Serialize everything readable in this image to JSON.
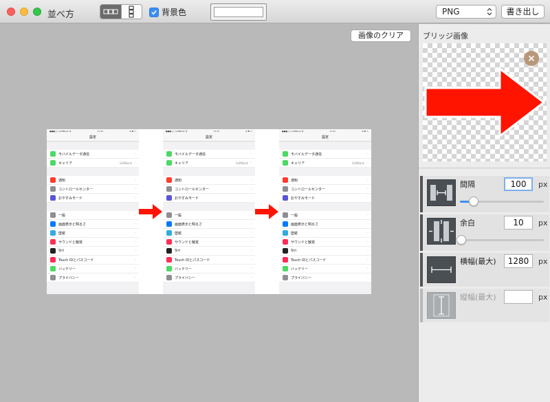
{
  "window": {
    "title": "並べ方"
  },
  "toolbar": {
    "layout_modes": [
      "horizontal-layout-icon",
      "vertical-layout-icon"
    ],
    "background_checkbox_label": "背景色",
    "background_checked": true,
    "format_selected": "PNG",
    "export_label": "書き出し"
  },
  "canvas": {
    "clear_label": "画像のクリア",
    "phones": [
      {
        "status_left": "●●●○○ SoftBank 令",
        "status_center": "17:47",
        "status_right": "⊕ ✱ ▭",
        "nav_title": "設定",
        "carrier_detail": "SoftBank",
        "groups": [
          [
            {
              "label": "モバイルデータ通信",
              "color": "#4cd964"
            },
            {
              "label": "キャリア",
              "color": "#4cd964",
              "detail": "SoftBank"
            }
          ],
          [
            {
              "label": "通知",
              "color": "#ff3b30"
            },
            {
              "label": "コントロールセンター",
              "color": "#8e8e93"
            },
            {
              "label": "おやすみモード",
              "color": "#5856d6"
            }
          ],
          [
            {
              "label": "一般",
              "color": "#8e8e93"
            },
            {
              "label": "画面表示と明るさ",
              "color": "#007aff"
            },
            {
              "label": "壁紙",
              "color": "#34aadc"
            },
            {
              "label": "サウンドと触覚",
              "color": "#ff2d55"
            },
            {
              "label": "Siri",
              "color": "#222222"
            },
            {
              "label": "Touch IDとパスコード",
              "color": "#ff2d55"
            },
            {
              "label": "バッテリー",
              "color": "#4cd964"
            },
            {
              "label": "プライバシー",
              "color": "#8e8e93"
            }
          ]
        ]
      }
    ]
  },
  "sidebar": {
    "bridge_title": "ブリッジ画像",
    "settings": [
      {
        "label": "間隔",
        "value": "100",
        "unit": "px",
        "slider": 0.16,
        "focused": true,
        "disabled": false
      },
      {
        "label": "余白",
        "value": "10",
        "unit": "px",
        "slider": 0.02,
        "focused": false,
        "disabled": false
      },
      {
        "label": "横幅(最大)",
        "value": "1280",
        "unit": "px",
        "focused": false,
        "disabled": false
      },
      {
        "label": "縦幅(最大)",
        "value": "",
        "unit": "px",
        "focused": false,
        "disabled": true
      }
    ]
  },
  "colors": {
    "accent": "#3a8ff5",
    "arrow": "#ff1400"
  }
}
